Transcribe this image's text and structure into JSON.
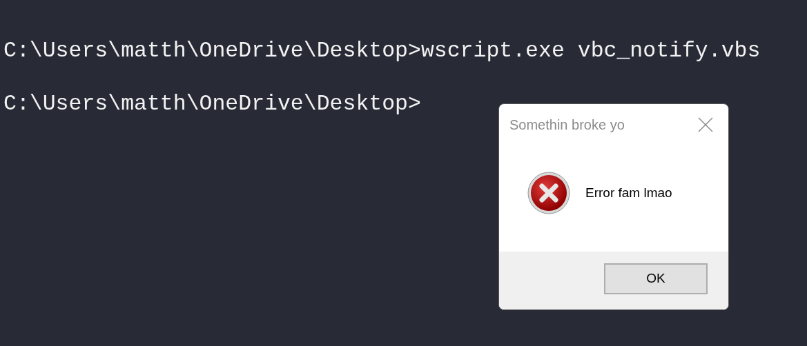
{
  "terminal": {
    "lines": [
      "C:\\Users\\matth\\OneDrive\\Desktop>wscript.exe vbc_notify.vbs",
      "C:\\Users\\matth\\OneDrive\\Desktop>"
    ]
  },
  "dialog": {
    "title": "Somethin broke yo",
    "message": "Error fam lmao",
    "buttons": [
      "OK"
    ]
  }
}
